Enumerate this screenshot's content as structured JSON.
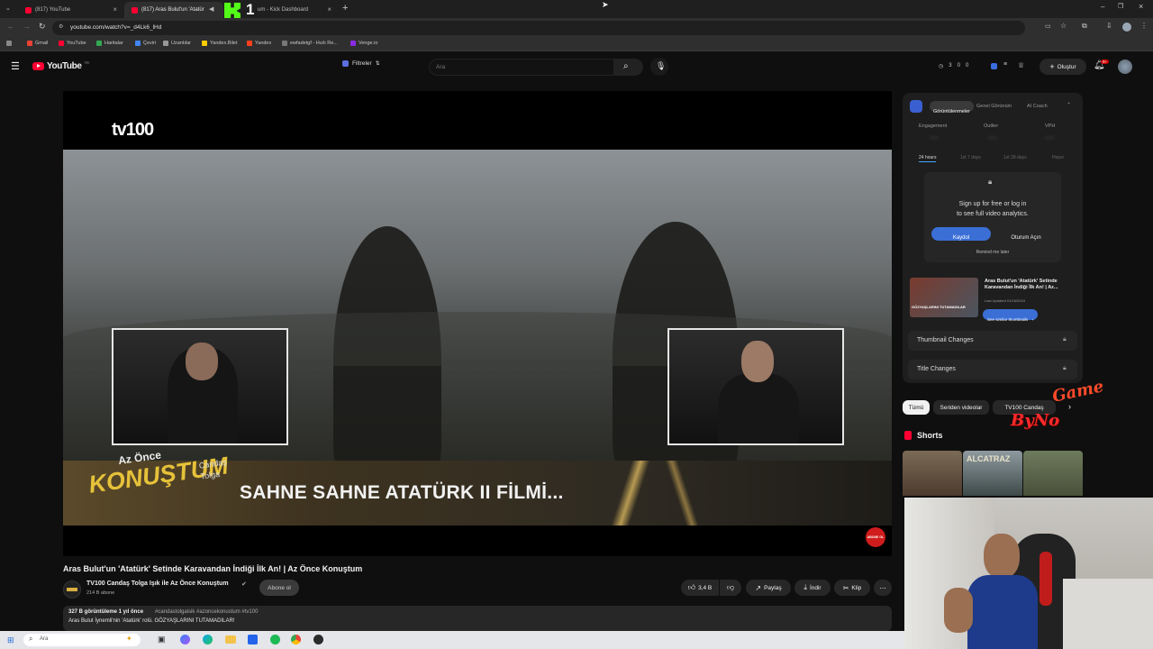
{
  "browser": {
    "tabs": [
      {
        "label": "(817) YouTube"
      },
      {
        "label": "(817) Aras Bulut'un 'Atatür"
      },
      {
        "label": "um - Kick Dashboard"
      }
    ],
    "new_tab_symbol": "+",
    "url": "youtube.com/watch?v=_d4Lk6_lHd",
    "bookmarks": [
      "Gmail",
      "YouTube",
      "Haritalar",
      "Çeviri",
      "Uzantılar",
      "Yandex.Bilet",
      "Yandex",
      "ewfadetgf - Hızlı Re...",
      "Venge.io"
    ]
  },
  "stream_overlay": {
    "kick_number": "1",
    "game_logo_text": "Game",
    "byno_text": "ByNo"
  },
  "youtube": {
    "logo_text": "YouTube",
    "country_code": "TR",
    "filters_label": "Filtreler",
    "search_placeholder": "Ara",
    "header_counts": [
      "3",
      "0",
      "0"
    ],
    "create_label": "Oluştur",
    "notification_badge": "9+"
  },
  "video": {
    "channel_watermark": "tv100",
    "caption": "SAHNE SAHNE ATATÜRK II FİLMİ...",
    "show_logo_top": "Az Önce",
    "show_logo_main": "KONUŞTUM",
    "show_logo_sub1": "Candaş",
    "show_logo_sub2": "Tolga",
    "subscribe_badge": "ABONE OL",
    "title": "Aras Bulut'un 'Atatürk' Setinde Karavandan İndiği İlk An! | Az Önce Konuştum",
    "channel_name": "TV100 Candaş Tolga Işık ile Az Önce Konuştum",
    "subscribers": "214 B abone",
    "subscribe_label": "Abone ol",
    "likes": "3,4 B",
    "share_label": "Paylaş",
    "download_label": "İndir",
    "clip_label": "Klip",
    "views_line": "327 B görüntüleme  1 yıl önce",
    "hashtags": "#candastolgaisik #azoncekonustum #tv100",
    "description_line": "Aras Bulut İynemli'nin 'Atatürk' rolü. GÖZYAŞLARINI TUTAMADILAR!"
  },
  "analytics_panel": {
    "tabs": [
      "Görüntülenmeler",
      "Genel Görünüm",
      "AI Coach"
    ],
    "metrics": [
      "Engagement",
      "Outlier",
      "VPH"
    ],
    "metric_values": [
      "###",
      "###",
      "###"
    ],
    "periods": [
      "24 hours",
      "1st 7 days",
      "1st 28 days",
      "Hepsi"
    ],
    "signup_line1": "Sign up for free or log in",
    "signup_line2": "to see full video analytics.",
    "register_label": "Kaydol",
    "login_label": "Oturum Açın",
    "remind_label": "Remind me later",
    "thumb_title": "Aras Bulut'un 'Atatürk' Setinde Karavandan İndiği İlk An! | Az...",
    "thumb_updated": "Last Updated 01/16/2024",
    "similar_label": "See similar thumbnails",
    "thumbnail_changes": "Thumbnail Changes",
    "title_changes": "Title Changes",
    "thumb_caption": "GÖZYAŞLARINI TUTAMADILAR"
  },
  "chips": [
    "Tümü",
    "Seriden videolar",
    "TV100 Candaş"
  ],
  "shorts": {
    "heading": "Shorts",
    "thumb2_text": "ALCATRAZ"
  },
  "taskbar": {
    "search_placeholder": "Ara"
  },
  "colors": {
    "accent_blue": "#3ea6ff",
    "register_blue": "#3b6fd6",
    "youtube_red": "#ff0033",
    "kick_green": "#53fc18"
  }
}
